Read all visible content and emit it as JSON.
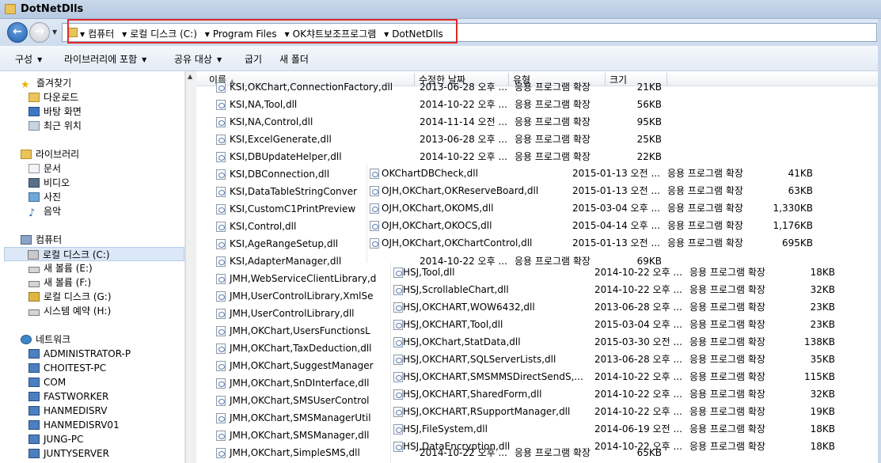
{
  "window": {
    "title": "DotNetDlls"
  },
  "nav": {
    "back_icon": "left-arrow-icon",
    "forward_icon": "right-arrow-icon",
    "breadcrumbs": [
      "컴퓨터",
      "로컬 디스크 (C:)",
      "Program Files",
      "OK챠트보조프로그램",
      "DotNetDlls"
    ]
  },
  "toolbar": {
    "organize": "구성",
    "include_library": "라이브러리에 포함",
    "share_with": "공유 대상",
    "burn": "굽기",
    "new_folder": "새 폴더"
  },
  "sidebar": {
    "favorites": {
      "label": "즐겨찾기",
      "items": [
        "다운로드",
        "바탕 화면",
        "최근 위치"
      ]
    },
    "libraries": {
      "label": "라이브러리",
      "items": [
        "문서",
        "비디오",
        "사진",
        "음악"
      ]
    },
    "computer": {
      "label": "컴퓨터",
      "items": [
        "로컬 디스크 (C:)",
        "새 볼륨 (E:)",
        "새 볼륨 (F:)",
        "로컬 디스크 (G:)",
        "시스템 예약 (H:)"
      ]
    },
    "network": {
      "label": "네트워크",
      "items": [
        "ADMINISTRATOR-P",
        "CHOITEST-PC",
        "COM",
        "FASTWORKER",
        "HANMEDISRV",
        "HANMEDISRV01",
        "JUNG-PC",
        "JUNTYSERVER"
      ]
    }
  },
  "columns": {
    "name": "이름",
    "date": "수정한 날짜",
    "type": "유형",
    "size": "크기"
  },
  "main_files": [
    {
      "name": "KSI,OKChart,ConnectionFactory,dll",
      "date": "2013-06-28 오후 ...",
      "type": "응용 프로그램 확장",
      "size": "21KB"
    },
    {
      "name": "KSI,NA,Tool,dll",
      "date": "2014-10-22 오후 ...",
      "type": "응용 프로그램 확장",
      "size": "56KB"
    },
    {
      "name": "KSI,NA,Control,dll",
      "date": "2014-11-14 오전 ...",
      "type": "응용 프로그램 확장",
      "size": "95KB"
    },
    {
      "name": "KSI,ExcelGenerate,dll",
      "date": "2013-06-28 오후 ...",
      "type": "응용 프로그램 확장",
      "size": "25KB"
    },
    {
      "name": "KSI,DBUpdateHelper,dll",
      "date": "2014-10-22 오후 ...",
      "type": "응용 프로그램 확장",
      "size": "22KB"
    },
    {
      "name": "KSI,DBConnection,dll",
      "date": "",
      "type": "",
      "size": ""
    },
    {
      "name": "KSI,DataTableStringConver",
      "date": "",
      "type": "",
      "size": ""
    },
    {
      "name": "KSI,CustomC1PrintPreview",
      "date": "",
      "type": "",
      "size": ""
    },
    {
      "name": "KSI,Control,dll",
      "date": "",
      "type": "",
      "size": ""
    },
    {
      "name": "KSI,AgeRangeSetup,dll",
      "date": "",
      "type": "",
      "size": ""
    },
    {
      "name": "KSI,AdapterManager,dll",
      "date": "2014-10-22 오후 ...",
      "type": "응용 프로그램 확장",
      "size": "69KB"
    },
    {
      "name": "JMH,WebServiceClientLibrary,d",
      "date": "",
      "type": "",
      "size": ""
    },
    {
      "name": "JMH,UserControlLibrary,XmlSe",
      "date": "",
      "type": "",
      "size": ""
    },
    {
      "name": "JMH,UserControlLibrary,dll",
      "date": "",
      "type": "",
      "size": ""
    },
    {
      "name": "JMH,OKChart,UsersFunctionsL",
      "date": "",
      "type": "",
      "size": ""
    },
    {
      "name": "JMH,OKChart,TaxDeduction,dll",
      "date": "",
      "type": "",
      "size": ""
    },
    {
      "name": "JMH,OKChart,SuggestManager",
      "date": "",
      "type": "",
      "size": ""
    },
    {
      "name": "JMH,OKChart,SnDInterface,dll",
      "date": "",
      "type": "",
      "size": ""
    },
    {
      "name": "JMH,OKChart,SMSUserControl",
      "date": "",
      "type": "",
      "size": ""
    },
    {
      "name": "JMH,OKChart,SMSManagerUtil",
      "date": "",
      "type": "",
      "size": ""
    },
    {
      "name": "JMH,OKChart,SMSManager,dll",
      "date": "",
      "type": "",
      "size": ""
    },
    {
      "name": "JMH,OKChart,SimpleSMS,dll",
      "date": "2014-10-22 오후 ...",
      "type": "응용 프로그램 확장",
      "size": "65KB"
    }
  ],
  "overlay1_files": [
    {
      "name": "OKChartDBCheck,dll",
      "date": "2015-01-13 오전 ...",
      "type": "응용 프로그램 확장",
      "size": "41KB"
    },
    {
      "name": "OJH,OKChart,OKReserveBoard,dll",
      "date": "2015-01-13 오전 ...",
      "type": "응용 프로그램 확장",
      "size": "63KB"
    },
    {
      "name": "OJH,OKChart,OKOMS,dll",
      "date": "2015-03-04 오후 ...",
      "type": "응용 프로그램 확장",
      "size": "1,330KB"
    },
    {
      "name": "OJH,OKChart,OKOCS,dll",
      "date": "2015-04-14 오후 ...",
      "type": "응용 프로그램 확장",
      "size": "1,176KB"
    },
    {
      "name": "OJH,OKChart,OKChartControl,dll",
      "date": "2015-01-13 오전 ...",
      "type": "응용 프로그램 확장",
      "size": "695KB"
    }
  ],
  "overlay2_files": [
    {
      "name": "HSJ,Tool,dll",
      "date": "2014-10-22 오후 ...",
      "type": "응용 프로그램 확장",
      "size": "18KB"
    },
    {
      "name": "HSJ,ScrollableChart,dll",
      "date": "2014-10-22 오후 ...",
      "type": "응용 프로그램 확장",
      "size": "32KB"
    },
    {
      "name": "HSJ,OKCHART,WOW6432,dll",
      "date": "2013-06-28 오후 ...",
      "type": "응용 프로그램 확장",
      "size": "23KB"
    },
    {
      "name": "HSJ,OKCHART,Tool,dll",
      "date": "2015-03-04 오후 ...",
      "type": "응용 프로그램 확장",
      "size": "23KB"
    },
    {
      "name": "HSJ,OKChart,StatData,dll",
      "date": "2015-03-30 오전 ...",
      "type": "응용 프로그램 확장",
      "size": "138KB"
    },
    {
      "name": "HSJ,OKCHART,SQLServerLists,dll",
      "date": "2013-06-28 오후 ...",
      "type": "응용 프로그램 확장",
      "size": "35KB"
    },
    {
      "name": "HSJ,OKCHART,SMSMMSDirectSendS,...",
      "date": "2014-10-22 오후 ...",
      "type": "응용 프로그램 확장",
      "size": "115KB"
    },
    {
      "name": "HSJ,OKCHART,SharedForm,dll",
      "date": "2014-10-22 오후 ...",
      "type": "응용 프로그램 확장",
      "size": "32KB"
    },
    {
      "name": "HSJ,OKCHART,RSupportManager,dll",
      "date": "2014-10-22 오후 ...",
      "type": "응용 프로그램 확장",
      "size": "19KB"
    },
    {
      "name": "HSJ,FileSystem,dll",
      "date": "2014-06-19 오전 ...",
      "type": "응용 프로그램 확장",
      "size": "18KB"
    },
    {
      "name": "HSJ,DataEncryption,dll",
      "date": "2014-10-22 오후 ...",
      "type": "응용 프로그램 확장",
      "size": "18KB"
    }
  ]
}
